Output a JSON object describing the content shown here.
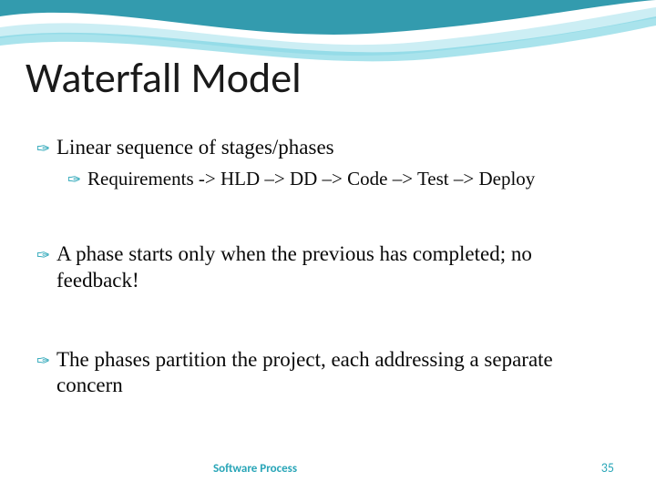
{
  "title": "Waterfall Model",
  "bullets": {
    "b1": "Linear sequence of stages/phases",
    "b1_1": "Requirements -> HLD –> DD –> Code –> Test –> Deploy",
    "b2": "A phase starts only when the previous has completed; no feedback!",
    "b3": "The phases partition the project, each addressing a separate concern"
  },
  "footer": {
    "label": "Software Process",
    "page": "35"
  },
  "colors": {
    "accent": "#2aa6b8"
  }
}
